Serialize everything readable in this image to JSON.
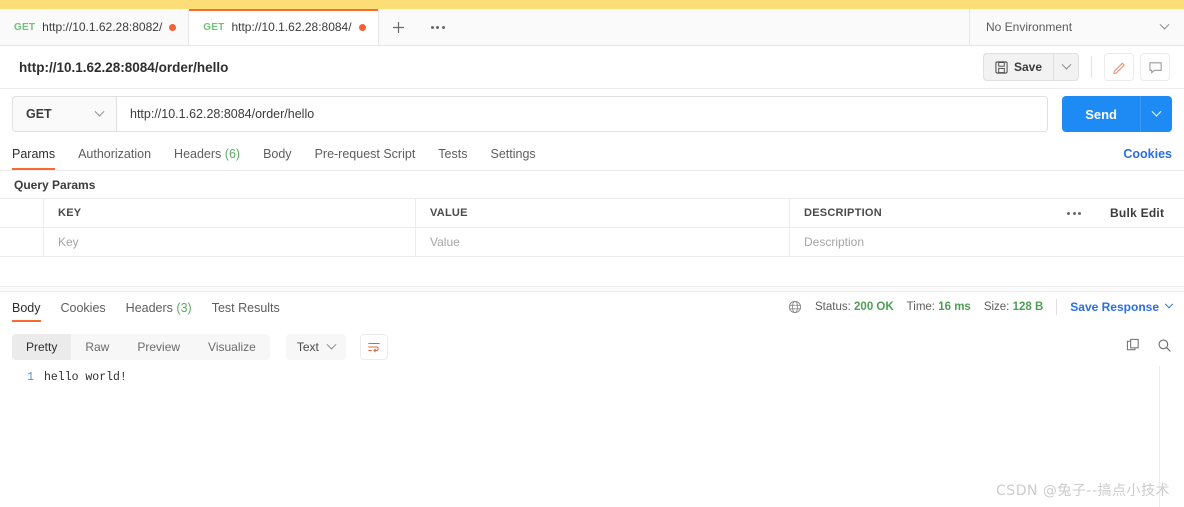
{
  "window": {
    "accent_orange": "#fa6a32",
    "accent_blue": "#1e8bf5",
    "top_strip_color": "#fcdd76"
  },
  "tabbar": {
    "tabs": [
      {
        "method": "GET",
        "title": "http://10.1.62.28:8082/",
        "unsaved": true,
        "active": false
      },
      {
        "method": "GET",
        "title": "http://10.1.62.28:8084/",
        "unsaved": true,
        "active": true
      }
    ],
    "new_tab_label": "+",
    "more_label": "more-options",
    "environment": "No Environment"
  },
  "title_row": {
    "request_title": "http://10.1.62.28:8084/order/hello",
    "save_label": "Save"
  },
  "url_row": {
    "method": "GET",
    "url": "http://10.1.62.28:8084/order/hello",
    "send_label": "Send"
  },
  "request_tabs": {
    "items": [
      {
        "label": "Params",
        "count": "",
        "active": true
      },
      {
        "label": "Authorization",
        "count": "",
        "active": false
      },
      {
        "label": "Headers",
        "count": "(6)",
        "active": false
      },
      {
        "label": "Body",
        "count": "",
        "active": false
      },
      {
        "label": "Pre-request Script",
        "count": "",
        "active": false
      },
      {
        "label": "Tests",
        "count": "",
        "active": false
      },
      {
        "label": "Settings",
        "count": "",
        "active": false
      }
    ],
    "cookies_link": "Cookies"
  },
  "query_params": {
    "section_label": "Query Params",
    "headers": {
      "key": "KEY",
      "value": "VALUE",
      "description": "DESCRIPTION"
    },
    "bulk_edit_label": "Bulk Edit",
    "rows": [
      {
        "key": "",
        "value": "",
        "description": ""
      }
    ],
    "placeholders": {
      "key": "Key",
      "value": "Value",
      "description": "Description"
    }
  },
  "response": {
    "tabs": [
      {
        "label": "Body",
        "count": "",
        "active": true
      },
      {
        "label": "Cookies",
        "count": "",
        "active": false
      },
      {
        "label": "Headers",
        "count": "(3)",
        "active": false
      },
      {
        "label": "Test Results",
        "count": "",
        "active": false
      }
    ],
    "status_label": "Status:",
    "status_value": "200 OK",
    "time_label": "Time:",
    "time_value": "16 ms",
    "size_label": "Size:",
    "size_value": "128 B",
    "save_response_label": "Save Response"
  },
  "body_toolbar": {
    "views": [
      {
        "label": "Pretty",
        "active": true
      },
      {
        "label": "Raw",
        "active": false
      },
      {
        "label": "Preview",
        "active": false
      },
      {
        "label": "Visualize",
        "active": false
      }
    ],
    "format": "Text"
  },
  "body_content": {
    "lines": [
      {
        "no": "1",
        "text": "hello world!"
      }
    ]
  },
  "watermark": "CSDN @兔子--搞点小技术"
}
